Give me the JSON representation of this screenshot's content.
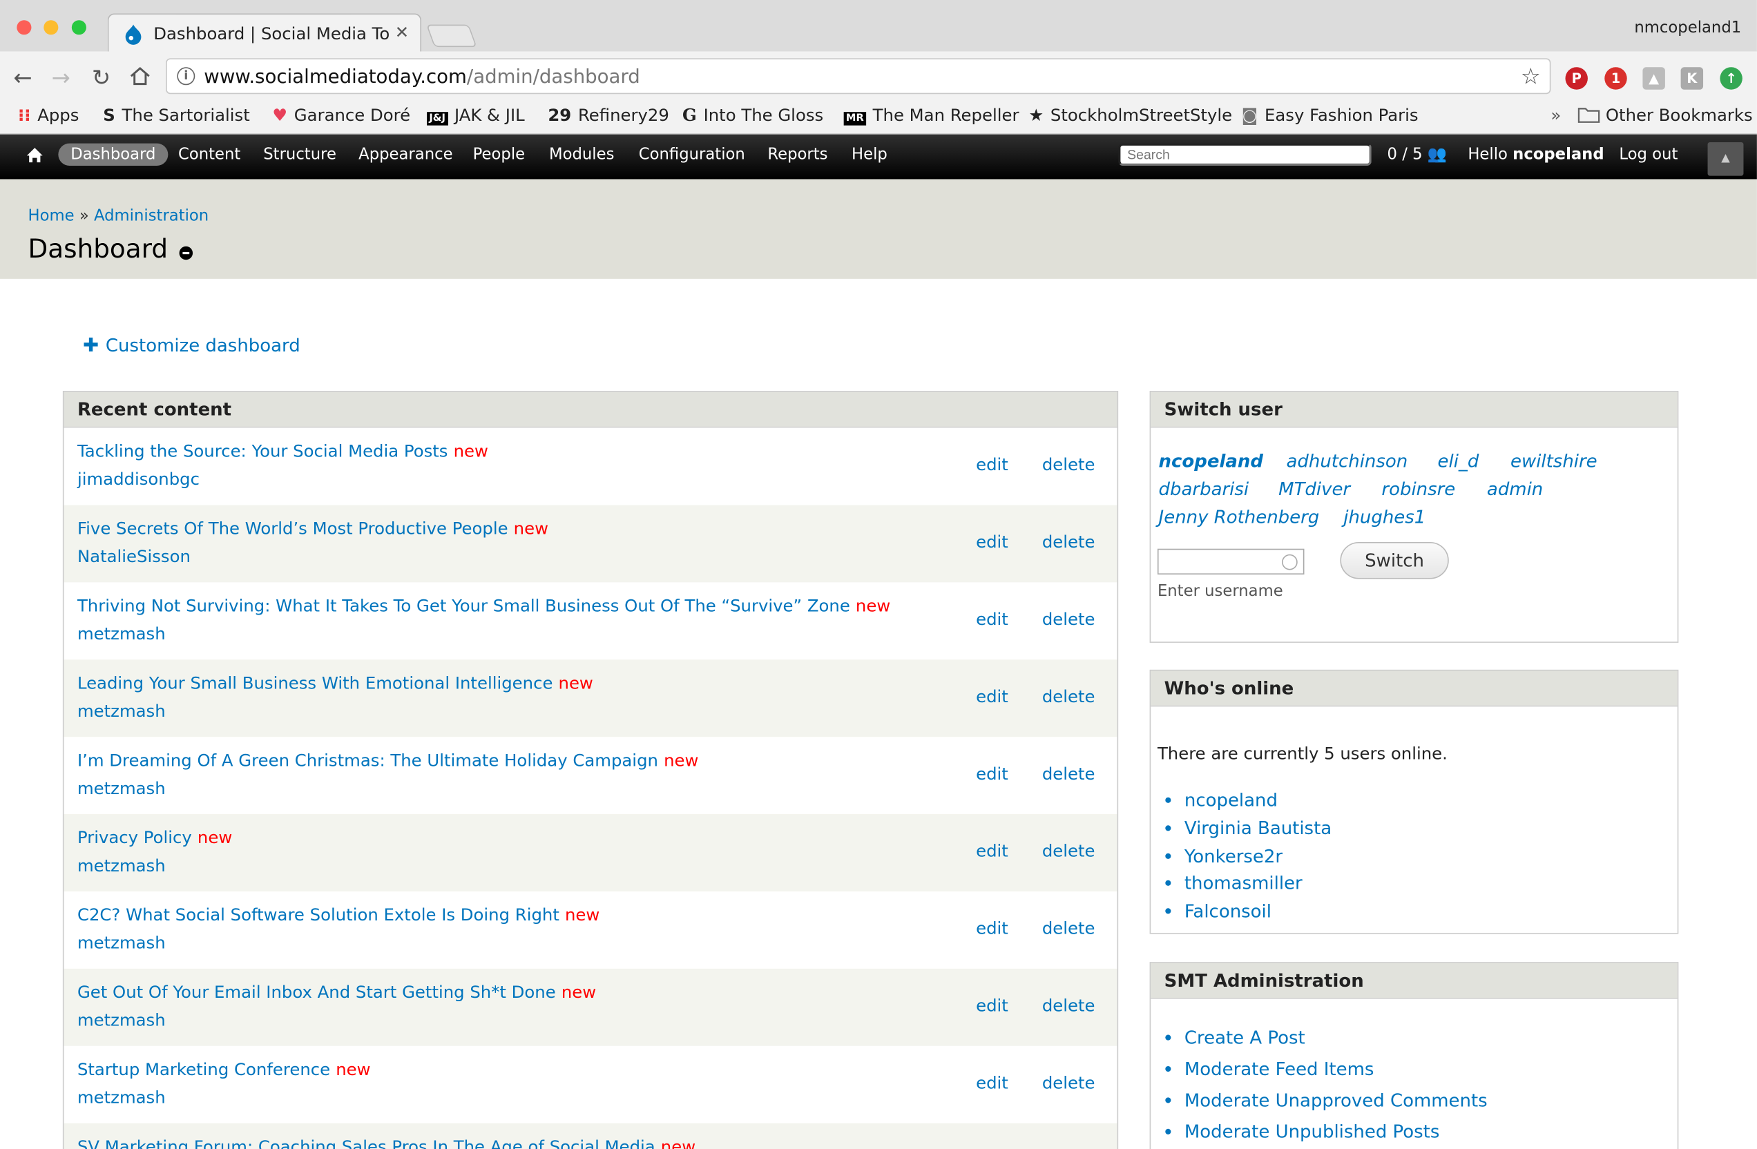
{
  "browser": {
    "tab_title": "Dashboard | Social Media Toda",
    "profile": "nmcopeland1",
    "url_host": "www.socialmediatoday.com",
    "url_path": "/admin/dashboard",
    "bookmarks": [
      "Apps",
      "The Sartorialist",
      "Garance Doré",
      "JAK & JIL",
      "Refinery29",
      "Into The Gloss",
      "The Man Repeller",
      "StockholmStreetStyle",
      "Easy Fashion Paris"
    ],
    "other_bookmarks": "Other Bookmarks",
    "overflow": "»"
  },
  "admin_bar": {
    "items": [
      "Dashboard",
      "Content",
      "Structure",
      "Appearance",
      "People",
      "Modules",
      "Configuration",
      "Reports",
      "Help"
    ],
    "search_placeholder": "Search",
    "users_count": "0 / 5",
    "hello": "Hello",
    "username": "ncopeland",
    "logout": "Log out"
  },
  "header": {
    "crumb_home": "Home",
    "crumb_sep": "»",
    "crumb_admin": "Administration",
    "title": "Dashboard"
  },
  "customize": "Customize dashboard",
  "recent": {
    "title": "Recent content",
    "edit": "edit",
    "delete": "delete",
    "new": "new",
    "rows": [
      {
        "title": "Tackling the Source: Your Social Media Posts",
        "author": "jimaddisonbgc"
      },
      {
        "title": "Five Secrets Of The World’s Most Productive People",
        "author": "NatalieSisson"
      },
      {
        "title": "Thriving Not Surviving: What It Takes To Get Your Small Business Out Of The “Survive” Zone",
        "author": "metzmash"
      },
      {
        "title": "Leading Your Small Business With Emotional Intelligence",
        "author": "metzmash"
      },
      {
        "title": "I’m Dreaming Of A Green Christmas: The Ultimate Holiday Campaign",
        "author": "metzmash"
      },
      {
        "title": "Privacy Policy",
        "author": "metzmash"
      },
      {
        "title": "C2C? What Social Software Solution Extole Is Doing Right",
        "author": "metzmash"
      },
      {
        "title": "Get Out Of Your Email Inbox And Start Getting Sh*t Done",
        "author": "metzmash"
      },
      {
        "title": "Startup Marketing Conference",
        "author": "metzmash"
      },
      {
        "title": "SV Marketing Forum: Coaching Sales Pros In The Age of Social Media",
        "author": ""
      }
    ]
  },
  "switch_user": {
    "title": "Switch user",
    "users": [
      "ncopeland",
      "adhutchinson",
      "eli_d",
      "ewiltshire",
      "dbarbarisi",
      "MTdiver",
      "robinsre",
      "admin",
      "Jenny Rothenberg",
      "jhughes1"
    ],
    "button": "Switch",
    "help": "Enter username"
  },
  "whos_online": {
    "title": "Who's online",
    "text": "There are currently 5 users online.",
    "users": [
      "ncopeland",
      "Virginia Bautista",
      "Yonkerse2r",
      "thomasmiller",
      "Falconsoil"
    ]
  },
  "smt": {
    "title": "SMT Administration",
    "links": [
      "Create A Post",
      "Moderate Feed Items",
      "Moderate Unapproved Comments",
      "Moderate Unpublished Posts"
    ]
  },
  "colors": {
    "link": "#0074bd",
    "new": "#ff0000",
    "header_bg": "#e0e0d8"
  }
}
